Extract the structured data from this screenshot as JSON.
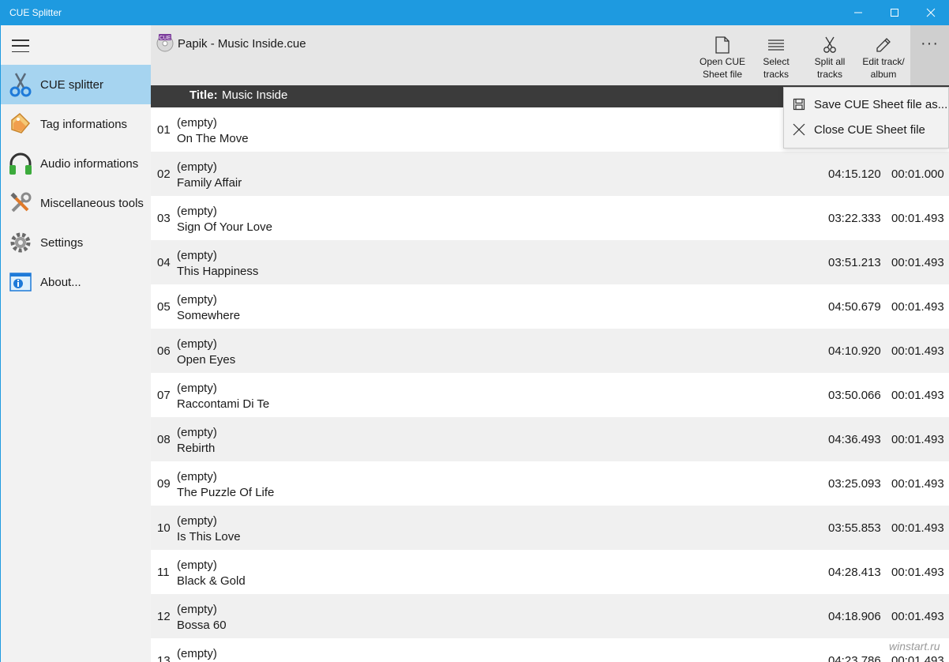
{
  "window": {
    "title": "CUE Splitter",
    "controls": [
      "minimize",
      "maximize",
      "close"
    ]
  },
  "sidebar": {
    "items": [
      {
        "label": "CUE splitter",
        "icon": "scissors-icon",
        "active": true
      },
      {
        "label": "Tag informations",
        "icon": "tag-icon",
        "active": false
      },
      {
        "label": "Audio informations",
        "icon": "headphones-icon",
        "active": false
      },
      {
        "label": "Miscellaneous tools",
        "icon": "tools-icon",
        "active": false
      },
      {
        "label": "Settings",
        "icon": "gear-icon",
        "active": false
      },
      {
        "label": "About...",
        "icon": "info-icon",
        "active": false
      }
    ]
  },
  "header": {
    "file_icon_text": "CUE",
    "file_name": "Papik - Music Inside.cue",
    "toolbar": {
      "open": "Open CUE Sheet file",
      "open_line1": "Open CUE",
      "open_line2": "Sheet file",
      "select_line1": "Select",
      "select_line2": "tracks",
      "split_line1": "Split all",
      "split_line2": "tracks",
      "edit_line1": "Edit track/",
      "edit_line2": "album",
      "more": "···"
    }
  },
  "album": {
    "title_key": "Title:",
    "title_value": "Music Inside"
  },
  "tracks": [
    {
      "num": "01",
      "artist": "(empty)",
      "title": "On The Move",
      "duration": "",
      "gap": ""
    },
    {
      "num": "02",
      "artist": "(empty)",
      "title": "Family Affair",
      "duration": "04:15.120",
      "gap": "00:01.000"
    },
    {
      "num": "03",
      "artist": "(empty)",
      "title": "Sign Of Your Love",
      "duration": "03:22.333",
      "gap": "00:01.493"
    },
    {
      "num": "04",
      "artist": "(empty)",
      "title": "This Happiness",
      "duration": "03:51.213",
      "gap": "00:01.493"
    },
    {
      "num": "05",
      "artist": "(empty)",
      "title": "Somewhere",
      "duration": "04:50.679",
      "gap": "00:01.493"
    },
    {
      "num": "06",
      "artist": "(empty)",
      "title": "Open Eyes",
      "duration": "04:10.920",
      "gap": "00:01.493"
    },
    {
      "num": "07",
      "artist": "(empty)",
      "title": "Raccontami Di Te",
      "duration": "03:50.066",
      "gap": "00:01.493"
    },
    {
      "num": "08",
      "artist": "(empty)",
      "title": "Rebirth",
      "duration": "04:36.493",
      "gap": "00:01.493"
    },
    {
      "num": "09",
      "artist": "(empty)",
      "title": "The Puzzle Of Life",
      "duration": "03:25.093",
      "gap": "00:01.493"
    },
    {
      "num": "10",
      "artist": "(empty)",
      "title": "Is This Love",
      "duration": "03:55.853",
      "gap": "00:01.493"
    },
    {
      "num": "11",
      "artist": "(empty)",
      "title": "Black & Gold",
      "duration": "04:28.413",
      "gap": "00:01.493"
    },
    {
      "num": "12",
      "artist": "(empty)",
      "title": "Bossa 60",
      "duration": "04:18.906",
      "gap": "00:01.493"
    },
    {
      "num": "13",
      "artist": "(empty)",
      "title": "",
      "duration": "04:23.786",
      "gap": "00:01.493"
    }
  ],
  "menu": {
    "items": [
      {
        "label": "Save CUE Sheet file as...",
        "icon": "save-icon"
      },
      {
        "label": "Close CUE Sheet file",
        "icon": "close-icon"
      }
    ]
  },
  "watermark": "winstart.ru",
  "colors": {
    "titlebar": "#1e9ae0",
    "active_nav": "#a6d4f0",
    "header_bg": "#e6e6e6",
    "title_band": "#3b3b3b",
    "alt_row": "#f0f0f0"
  }
}
